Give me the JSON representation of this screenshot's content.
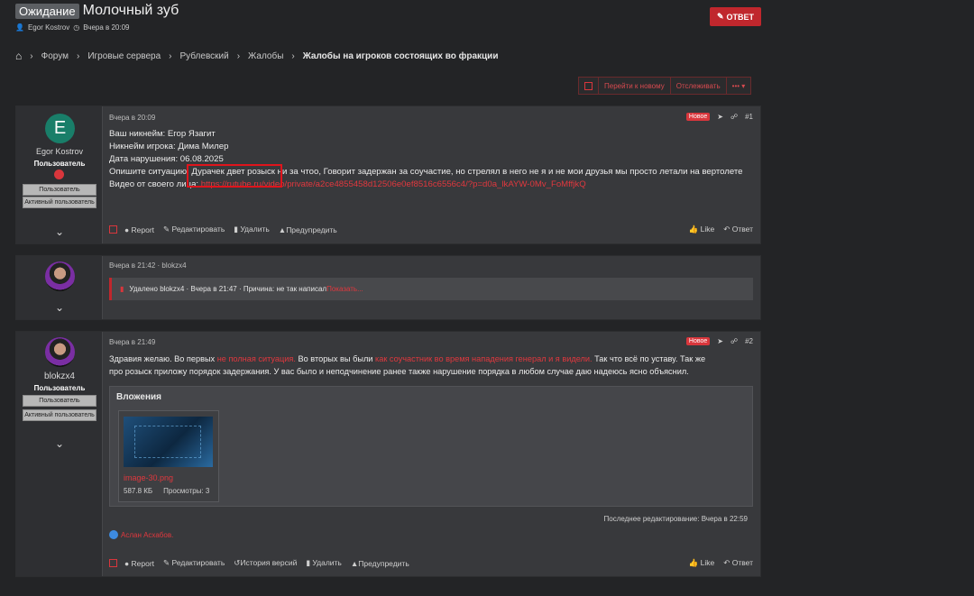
{
  "header": {
    "status_label": "Ожидание",
    "title": "Молочный зуб",
    "author": "Egor Kostrov",
    "created": "Вчера в 20:09",
    "reply_label": "ОТВЕТ"
  },
  "breadcrumb": {
    "items": [
      "Форум",
      "Игровые сервера",
      "Рублевский",
      "Жалобы"
    ],
    "current": "Жалобы на игроков состоящих во фракции"
  },
  "toolbar": {
    "goto_new": "Перейти к новому",
    "watch": "Отслеживать",
    "more": "•••"
  },
  "post1": {
    "author": "Egor Kostrov",
    "avatar_letter": "E",
    "role": "Пользователь",
    "badge1": "Пользователь",
    "badge2": "Активный пользователь",
    "time": "Вчера в 20:09",
    "new_label": "Новое",
    "number": "#1",
    "line1": "Ваш никнейм: Егор Язагит",
    "line2": "Никнейм игрока: Дима Милер",
    "line3": "Дата нарушения: 06.08.2025",
    "line4_prefix": "Опишите ситуацию: ",
    "line4_hl": "Дурачек двет розыск",
    "line4_rest": " ни за чтоо, Говорит задержан за соучастие, но стрелял в него не я и не мои друзья мы просто летали на вертолете",
    "line5_prefix": "Видео от своего лица: ",
    "line5_link": "https://rutube.ru/video/private/a2ce4855458d12506e0ef8516c6556c4/?p=d0a_lkAYW-0Mv_FoMffjkQ",
    "actions": {
      "report": "Report",
      "edit": "Редактировать",
      "delete": "Удалить",
      "warn": "Предупредить",
      "like": "Like",
      "reply": "Ответ"
    }
  },
  "post_deleted": {
    "time": "Вчера в 21:42 · blokzx4",
    "message_prefix": "Удалено blokzx4 · Вчера в 21:47 · Причина: не так написал ",
    "show_link": "Показать..."
  },
  "post2": {
    "author": "blokzx4",
    "role": "Пользователь",
    "badge1": "Пользователь",
    "badge2": "Активный пользователь",
    "time": "Вчера в 21:49",
    "new_label": "Новое",
    "number": "#2",
    "t1": "Здравия желаю. Во первых ",
    "t2": "не полная ситуация.",
    "t3": " Во вторых вы были ",
    "t4": "как соучастник во время нападения генерал и я видели.",
    "t5": " Так что всё по уставу. Так же",
    "line2": "про розыск приложу порядок задержания. У вас было и неподчинение ранее также нарушение порядка в любом случае даю надеюсь ясно объяснил.",
    "attachments_title": "Вложения",
    "file_name": "image-30.png",
    "file_size": "587.8 КБ",
    "file_views": "Просмотры: 3",
    "edited": "Последнее редактирование: Вчера в 22:59",
    "liked_by": "Аслан Асхабов.",
    "actions": {
      "report": "Report",
      "edit": "Редактировать",
      "history": "История версий",
      "delete": "Удалить",
      "warn": "Предупредить",
      "like": "Like",
      "reply": "Ответ"
    }
  }
}
